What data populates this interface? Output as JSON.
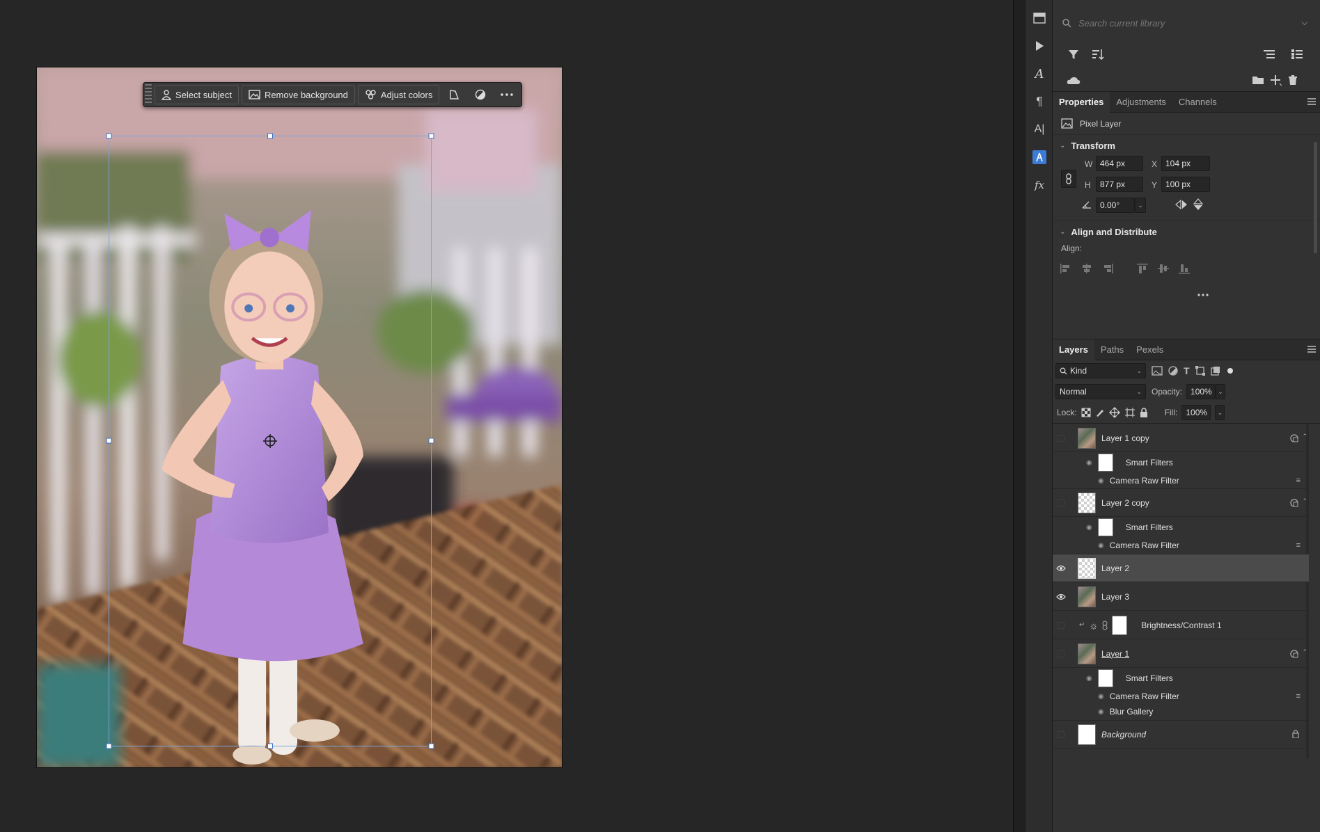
{
  "taskbar": {
    "select_subject": "Select subject",
    "remove_background": "Remove background",
    "adjust_colors": "Adjust colors"
  },
  "libraries": {
    "search_placeholder": "Search current library"
  },
  "properties_tabs": [
    "Properties",
    "Adjustments",
    "Channels"
  ],
  "properties": {
    "layer_type": "Pixel Layer",
    "transform_title": "Transform",
    "w_label": "W",
    "w_value": "464 px",
    "h_label": "H",
    "h_value": "877 px",
    "x_label": "X",
    "x_value": "104 px",
    "y_label": "Y",
    "y_value": "100 px",
    "angle_value": "0.00°",
    "align_title": "Align and Distribute",
    "align_label": "Align:"
  },
  "layers_tabs": [
    "Layers",
    "Paths",
    "Pexels"
  ],
  "layers_panel": {
    "kind_label": "Kind",
    "blend_mode": "Normal",
    "opacity_label": "Opacity:",
    "opacity_value": "100%",
    "lock_label": "Lock:",
    "fill_label": "Fill:",
    "fill_value": "100%"
  },
  "layers": [
    {
      "name": "Layer 1 copy",
      "visible": false,
      "thumb": "photo",
      "smart": true
    },
    {
      "name": "Smart Filters"
    },
    {
      "name": "Camera Raw Filter"
    },
    {
      "name": "Layer 2 copy",
      "visible": false,
      "thumb": "checker",
      "smart": true
    },
    {
      "name": "Smart Filters"
    },
    {
      "name": "Camera Raw Filter"
    },
    {
      "name": "Layer 2",
      "visible": true,
      "thumb": "checker",
      "selected": true
    },
    {
      "name": "Layer 3",
      "visible": true,
      "thumb": "photo"
    },
    {
      "name": "Brightness/Contrast 1",
      "visible": false,
      "thumb": "white"
    },
    {
      "name": "Layer 1",
      "visible": false,
      "thumb": "photo",
      "smart": true
    },
    {
      "name": "Smart Filters"
    },
    {
      "name": "Camera Raw Filter"
    },
    {
      "name": "Blur Gallery"
    },
    {
      "name": "Background",
      "visible": false,
      "thumb": "white",
      "locked": true
    }
  ]
}
